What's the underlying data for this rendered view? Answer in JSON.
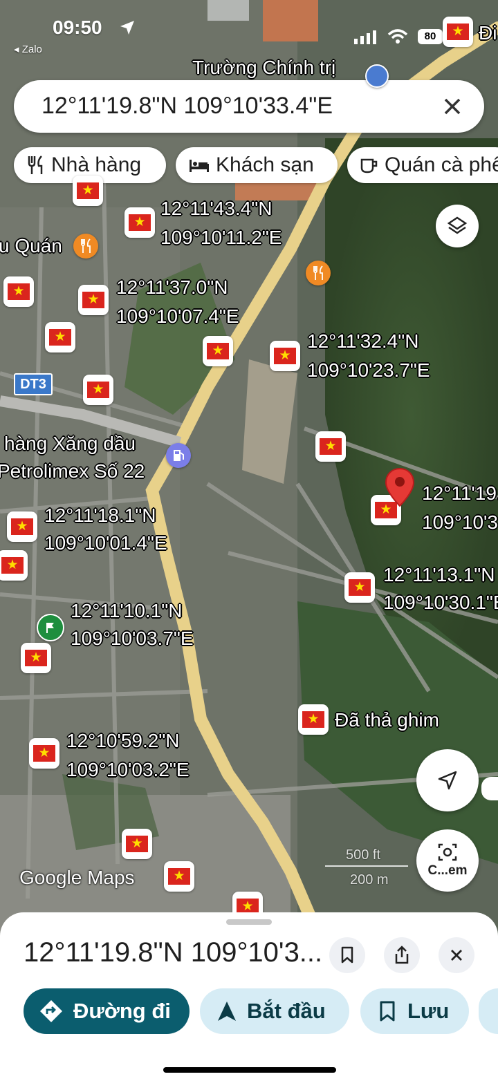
{
  "status_bar": {
    "time": "09:50",
    "back_app": "◂ Zalo",
    "battery": "80"
  },
  "search": {
    "query": "12°11'19.8\"N 109°10'33.4\"E"
  },
  "chips": [
    {
      "label": "Nhà hàng",
      "icon": "fork-knife-icon"
    },
    {
      "label": "Khách sạn",
      "icon": "bed-icon"
    },
    {
      "label": "Quán cà phê",
      "icon": "coffee-cup-icon"
    }
  ],
  "map_labels": {
    "school": "Trường Chính trị",
    "road_shield": "DT3",
    "restaurant": "u Quán",
    "gas_station_line1": "hàng Xăng dầu",
    "gas_station_line2": "Petrolimex Số 22",
    "corner_top": "Đi",
    "dropped_pin": "Đã thả ghim",
    "google_maps": "Google Maps",
    "scale_imperial": "500 ft",
    "scale_metric": "200 m",
    "lens_button": "C...em"
  },
  "coordinates": [
    {
      "lat": "12°11'43.4\"N",
      "lng": "109°10'11.2\"E"
    },
    {
      "lat": "12°11'37.0\"N",
      "lng": "109°10'07.4\"E"
    },
    {
      "lat": "12°11'32.4\"N",
      "lng": "109°10'23.7\"E"
    },
    {
      "lat": "12°11'19.8\"N",
      "lng": "109°10'33.4\"E"
    },
    {
      "lat": "12°11'18.1\"N",
      "lng": "109°10'01.4\"E"
    },
    {
      "lat": "12°11'13.1\"N",
      "lng": "109°10'30.1\"E"
    },
    {
      "lat": "12°11'10.1\"N",
      "lng": "109°10'03.7\"E"
    },
    {
      "lat": "12°10'59.2\"N",
      "lng": "109°10'03.2\"E"
    }
  ],
  "sheet": {
    "title": "12°11'19.8\"N 109°10'3..."
  },
  "actions": {
    "directions": "Đường đi",
    "start": "Bắt đầu",
    "save": "Lưu"
  },
  "colors": {
    "flag_red": "#da251d",
    "flag_star": "#ffde00",
    "pin_red": "#e53935",
    "primary_teal": "#0b5d6e",
    "action_light": "#d6ecf5",
    "road": "#e8d18a",
    "poi_orange": "#f08a24"
  }
}
